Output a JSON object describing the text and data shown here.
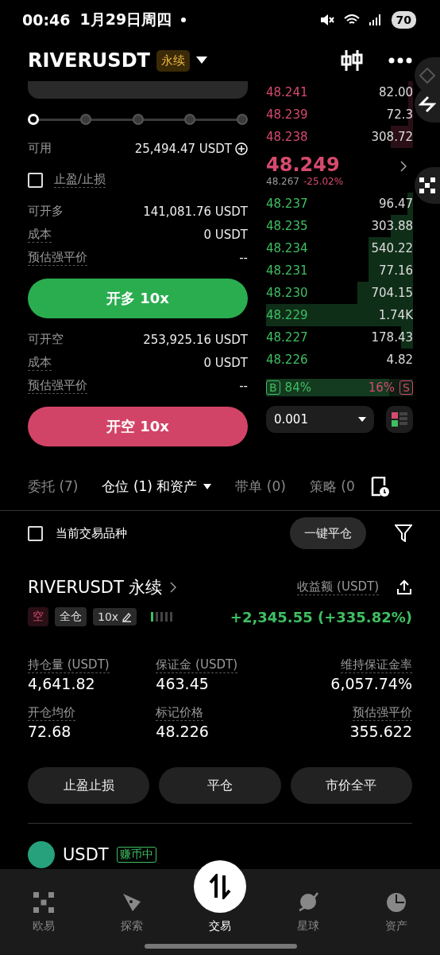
{
  "status_bar": {
    "time": "00:46",
    "date": "1月29日周四",
    "battery": "70"
  },
  "header": {
    "symbol": "RIVERUSDT",
    "badge": "永续"
  },
  "order_form": {
    "slider": {
      "level": 0
    },
    "available_label": "可用",
    "available_value": "25,494.47 USDT",
    "tpsl": {
      "label": "止盈/止损",
      "checked": false
    },
    "long": {
      "rows": [
        {
          "label": "可开多",
          "value": "141,081.76 USDT"
        },
        {
          "label": "成本",
          "value": "0 USDT"
        },
        {
          "label": "预估强平价",
          "value": "--"
        }
      ],
      "button": "开多 10x"
    },
    "short": {
      "rows": [
        {
          "label": "可开空",
          "value": "253,925.16 USDT"
        },
        {
          "label": "成本",
          "value": "0 USDT"
        },
        {
          "label": "预估强平价",
          "value": "--"
        }
      ],
      "button": "开空 10x"
    }
  },
  "order_book": {
    "asks": [
      {
        "price": "48.241",
        "size": "82.00"
      },
      {
        "price": "48.239",
        "size": "72.3"
      },
      {
        "price": "48.238",
        "size": "308.72"
      }
    ],
    "last_price": "48.249",
    "mark_price": "48.267",
    "change": "-25.02%",
    "bids": [
      {
        "price": "48.237",
        "size": "96.47"
      },
      {
        "price": "48.235",
        "size": "303.88"
      },
      {
        "price": "48.234",
        "size": "540.22"
      },
      {
        "price": "48.231",
        "size": "77.16"
      },
      {
        "price": "48.230",
        "size": "704.15"
      },
      {
        "price": "48.229",
        "size": "1.74K"
      },
      {
        "price": "48.227",
        "size": "178.43"
      },
      {
        "price": "48.226",
        "size": "4.82"
      }
    ],
    "ratio": {
      "buy_label": "B",
      "buy": "84%",
      "sell": "16%",
      "sell_label": "S",
      "level": 0.84
    },
    "precision": "0.001"
  },
  "tabs": [
    {
      "label": "委托 (7)",
      "selected": false
    },
    {
      "label": "仓位 (1) 和资产",
      "selected": true
    },
    {
      "label": "带单 (0)",
      "selected": false
    },
    {
      "label": "策略 (0",
      "selected": false
    }
  ],
  "filter": {
    "label": "当前交易品种",
    "checked": false,
    "close_all": "一键平仓"
  },
  "position": {
    "title": "RIVERUSDT 永续",
    "pnl_label": "收益额 (USDT)",
    "side": "空",
    "margin_mode": "全仓",
    "leverage": "10x",
    "pnl": "+2,345.55 (+335.82%)",
    "stats": [
      {
        "label": "持仓量 (USDT)",
        "value": "4,641.82"
      },
      {
        "label": "保证金 (USDT)",
        "value": "463.45"
      },
      {
        "label": "维持保证金率",
        "value": "6,057.74%"
      },
      {
        "label": "开仓均价",
        "value": "72.68"
      },
      {
        "label": "标记价格",
        "value": "48.226"
      },
      {
        "label": "预估强平价",
        "value": "355.622"
      }
    ],
    "actions": [
      "止盈止损",
      "平仓",
      "市价全平"
    ]
  },
  "asset": {
    "name": "USDT",
    "tag": "赚币中"
  },
  "nav": [
    {
      "label": "欧易",
      "selected": false
    },
    {
      "label": "探索",
      "selected": false
    },
    {
      "label": "交易",
      "selected": true
    },
    {
      "label": "星球",
      "selected": false
    },
    {
      "label": "资产",
      "selected": false
    }
  ]
}
